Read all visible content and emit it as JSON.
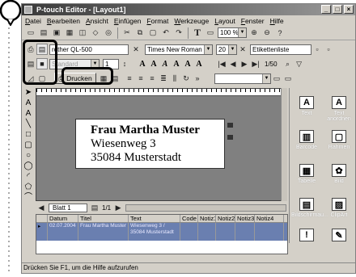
{
  "window": {
    "title": "P-touch Editor - [Layout1]"
  },
  "menu": [
    "Datei",
    "Bearbeiten",
    "Ansicht",
    "Einfügen",
    "Format",
    "Werkzeuge",
    "Layout",
    "Fenster",
    "Hilfe"
  ],
  "toolbar": {
    "zoom": "100 %",
    "text_tool_glyph": "T"
  },
  "printer": {
    "name": "rother QL-500",
    "media": "Standard",
    "copies": "1",
    "print_label": "Drucken"
  },
  "font": {
    "family": "Times New Roman",
    "size": "20"
  },
  "label_nav": {
    "name": "Etikettenliste",
    "page": "1/50"
  },
  "label_content": {
    "line1": "Frau Martha Muster",
    "line2": "Wiesenweg 3",
    "line3": "35084 Musterstadt"
  },
  "sheet": {
    "tab": "Blatt 1",
    "page": "1/1"
  },
  "right_panel": [
    "Text",
    "Text anordnen",
    "Barcode",
    "Rahmen",
    "Tabelle",
    "Bild",
    "Bildschirmau...",
    "ClipArt"
  ],
  "table": {
    "columns": [
      "",
      "Datum",
      "Titel",
      "Text",
      "Code",
      "Notiz1",
      "Notiz2",
      "Notiz3",
      "Notiz4"
    ],
    "rows": [
      [
        "",
        "02.07.2004",
        "Frau Martha Muster",
        "Wiesenweg 3 / 35084 Musterstadt",
        "",
        "",
        "",
        "",
        ""
      ]
    ]
  },
  "status": "Drücken Sie F1, um die Hilfe aufzurufen"
}
